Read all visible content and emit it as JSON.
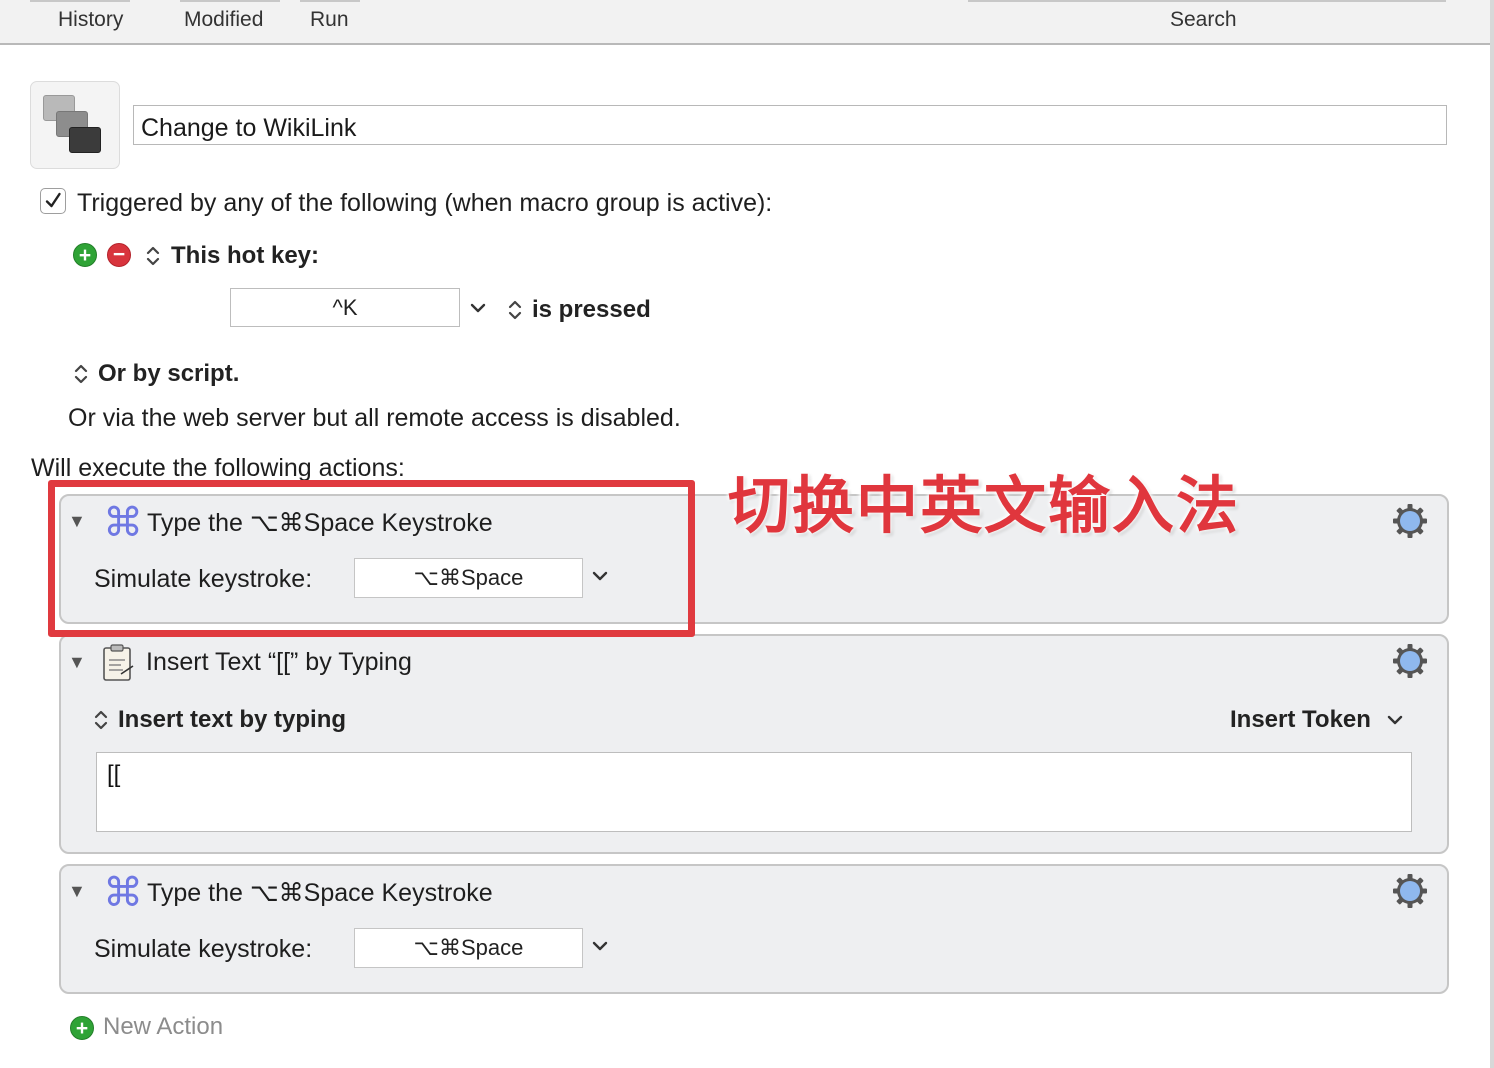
{
  "toolbar": {
    "history_label": "History",
    "modified_label": "Modified",
    "run_label": "Run",
    "search_label": "Search"
  },
  "macro": {
    "icon_name": "macro-windows-icon",
    "name": "Change to WikiLink"
  },
  "triggers": {
    "enabled": true,
    "header": "Triggered by any of the following (when macro group is active):",
    "trigger_type": "This hot key:",
    "hotkey_value": "^K",
    "hotkey_condition": "is pressed",
    "or_by_script": "Or by script.",
    "web_server_note": "Or via the web server but all remote access is disabled."
  },
  "actions_header": "Will execute the following actions:",
  "actions": [
    {
      "title": "Type the ⌥⌘Space Keystroke",
      "field_label": "Simulate keystroke:",
      "keystroke": "⌥⌘Space",
      "icon": "command-key-icon"
    },
    {
      "title": "Insert Text “[[” by Typing",
      "mode_label": "Insert text by typing",
      "token_label": "Insert Token",
      "text_value": "[[",
      "icon": "clipboard-icon"
    },
    {
      "title": "Type the ⌥⌘Space Keystroke",
      "field_label": "Simulate keystroke:",
      "keystroke": "⌥⌘Space",
      "icon": "command-key-icon"
    }
  ],
  "new_action_label": "New Action",
  "annotation": {
    "text": "切换中英文输入法",
    "color": "#e0363d"
  },
  "colors": {
    "accent_command": "#6f78e3",
    "plus_green": "#2fa336",
    "minus_red": "#d8343d",
    "gear_blue": "#8fb8ee"
  }
}
